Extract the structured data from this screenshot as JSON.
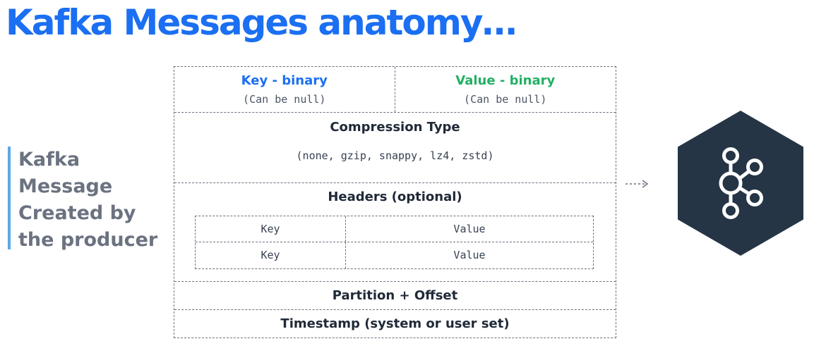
{
  "slide": {
    "title": "Kafka Messages anatomy…",
    "caption": "Kafka\nMessage\nCreated by\nthe producer"
  },
  "message": {
    "key": {
      "label": "Key - binary",
      "note": "(Can be null)"
    },
    "value": {
      "label": "Value - binary",
      "note": "(Can be null)"
    },
    "compression": {
      "title": "Compression Type",
      "options": "(none, gzip, snappy, lz4, zstd)"
    },
    "headers": {
      "title": "Headers (optional)",
      "rows": [
        {
          "key": "Key",
          "value": "Value"
        },
        {
          "key": "Key",
          "value": "Value"
        }
      ]
    },
    "partition_offset": "Partition + Offset",
    "timestamp": "Timestamp (system or user set)"
  },
  "logo": {
    "icon": "kafka-logo-icon",
    "background_color": "#253545",
    "mark_color": "#ffffff"
  },
  "colors": {
    "title": "#1b6ff2",
    "key_label": "#1b6ff2",
    "value_label": "#22b063",
    "caption": "#6b7280",
    "caption_bar": "#5aa7e8"
  }
}
